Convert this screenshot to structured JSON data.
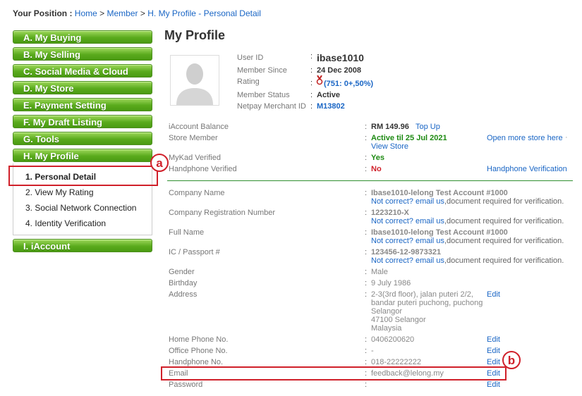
{
  "breadcrumb": {
    "label": "Your Position :",
    "home": "Home",
    "sep1": ">",
    "member": "Member",
    "sep2": ">",
    "current": "H. My Profile - Personal Detail"
  },
  "sidebar": {
    "items": [
      {
        "label": "A. My Buying"
      },
      {
        "label": "B. My Selling"
      },
      {
        "label": "C. Social Media & Cloud"
      },
      {
        "label": "D. My Store"
      },
      {
        "label": "E. Payment Setting"
      },
      {
        "label": "F. My Draft Listing"
      },
      {
        "label": "G. Tools"
      },
      {
        "label": "H. My Profile"
      },
      {
        "label": "I. iAccount"
      }
    ],
    "submenu": [
      {
        "num": "1.",
        "label": "Personal Detail"
      },
      {
        "num": "2.",
        "label": "View My Rating"
      },
      {
        "num": "3.",
        "label": "Social Network Connection"
      },
      {
        "num": "4.",
        "label": "Identity Verification"
      }
    ]
  },
  "callouts": {
    "a": "a",
    "b": "b"
  },
  "profile": {
    "title": "My Profile",
    "user_id_label": "User ID",
    "user_id": "ibase1010",
    "member_since_label": "Member Since",
    "member_since": "24 Dec 2008",
    "rating_label": "Rating",
    "rating_value": "(751: 0+,50%)",
    "member_status_label": "Member Status",
    "member_status": "Active",
    "netpay_label": "Netpay Merchant ID",
    "netpay_id": "M13802",
    "colon": ":"
  },
  "account": {
    "iaccount_label": "iAccount Balance",
    "iaccount_value": "RM 149.96",
    "topup": "Top Up",
    "store_label": "Store Member",
    "store_value": "Active til 25 Jul 2021",
    "view_store": "View Store",
    "open_more": "Open more store here",
    "mykad_label": "MyKad Verified",
    "mykad_value": "Yes",
    "hp_label": "Handphone Verified",
    "hp_value": "No",
    "hp_verify": "Handphone Verification"
  },
  "details": {
    "company_label": "Company Name",
    "company_value": "Ibase1010-lelong Test Account #1000",
    "not_correct": "Not correct? email us",
    "doc_required": ",document required for verification.",
    "reg_label": "Company Registration Number",
    "reg_value": "1223210-X",
    "fullname_label": "Full Name",
    "fullname_value": "Ibase1010-lelong Test Account #1000",
    "ic_label": "IC / Passport #",
    "ic_value": "123456-12-9873321",
    "gender_label": "Gender",
    "gender_value": "Male",
    "birthday_label": "Birthday",
    "birthday_value": "9 July 1986",
    "address_label": "Address",
    "address_lines": [
      "2-3(3rd floor), jalan puteri 2/2,",
      "bandar puteri puchong, puchong",
      "Selangor",
      "47100 Selangor",
      "Malaysia"
    ],
    "home_label": "Home Phone No.",
    "home_value": "0406200620",
    "office_label": "Office Phone No.",
    "office_value": "-",
    "hp_label": "Handphone No.",
    "hp_value": "018-22222222",
    "email_label": "Email",
    "email_value": "feedback@lelong.my",
    "password_label": "Password",
    "edit": "Edit"
  }
}
